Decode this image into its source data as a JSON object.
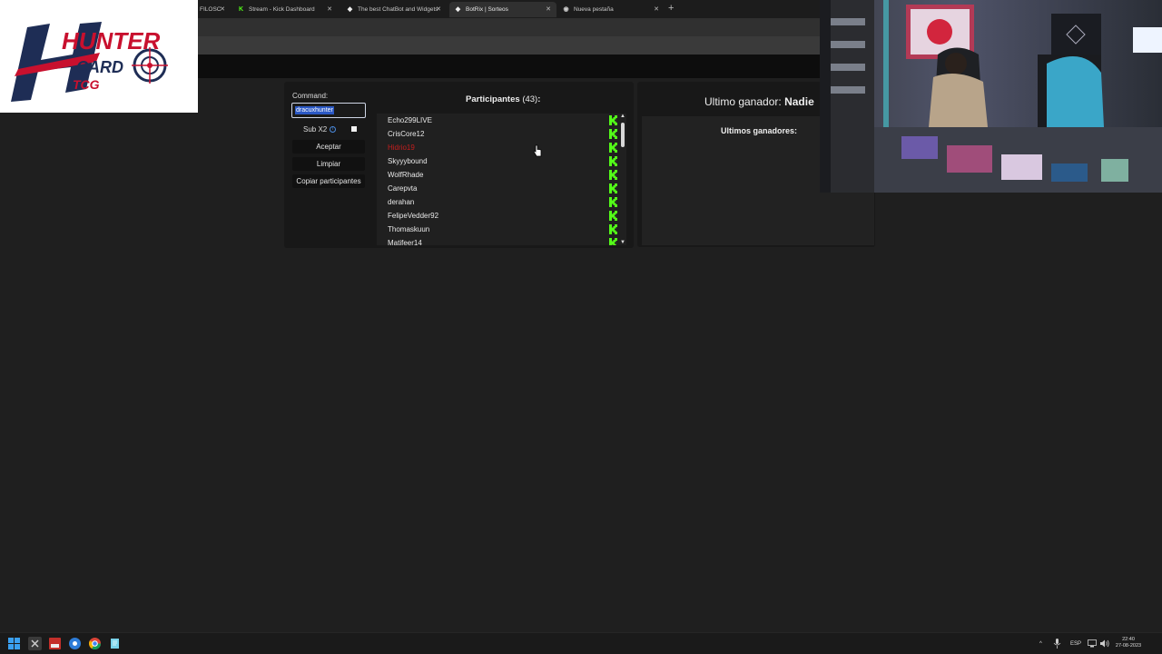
{
  "browser": {
    "tabs": [
      {
        "label": "FILOSC",
        "icon": ""
      },
      {
        "label": "Stream - Kick Dashboard",
        "icon": "kick-icon"
      },
      {
        "label": "The best ChatBot and Widgets",
        "icon": "botrix-icon"
      },
      {
        "label": "BotRix | Sorteos",
        "icon": "botrix-icon",
        "active": true
      },
      {
        "label": "Nueva pestaña",
        "icon": "globe-icon"
      }
    ],
    "close_glyph": "✕",
    "new_tab_glyph": "+"
  },
  "overlay_logo": {
    "line1": "HUNTER",
    "line2": "CARD",
    "line3": "TCG"
  },
  "giveaway": {
    "command_label": "Command:",
    "command_value": "dracuxhunter",
    "sub_label": "Sub X2",
    "sub_checked": false,
    "accept_label": "Aceptar",
    "clear_label": "Limpiar",
    "copy_label": "Copiar participantes",
    "participants_title": "Participantes",
    "participants_count": "(43)",
    "participants_colon": ":",
    "participants": [
      {
        "name": "Echo299LIVE",
        "color": "#e8e8e8"
      },
      {
        "name": "CrisCore12",
        "color": "#e8e8e8"
      },
      {
        "name": "Hidrio19",
        "color": "#c41e1e"
      },
      {
        "name": "Skyyybound",
        "color": "#e8e8e8"
      },
      {
        "name": "WolfRhade",
        "color": "#e8e8e8"
      },
      {
        "name": "Carepvta",
        "color": "#e8e8e8"
      },
      {
        "name": "derahan",
        "color": "#e8e8e8"
      },
      {
        "name": "FelipeVedder92",
        "color": "#e8e8e8"
      },
      {
        "name": "Thomaskuun",
        "color": "#e8e8e8"
      },
      {
        "name": "Matifeer14",
        "color": "#e8e8e8"
      }
    ],
    "kick_color": "#53fc18",
    "scroll_up": "▲",
    "scroll_down": "▼",
    "winner_label": "Ultimo ganador:",
    "winner_value": "Nadie",
    "last_winners_label": "Ultimos ganadores:"
  },
  "taskbar": {
    "language": "ESP",
    "time": "22:40",
    "date": "27-08-2023",
    "tray_up": "^"
  }
}
